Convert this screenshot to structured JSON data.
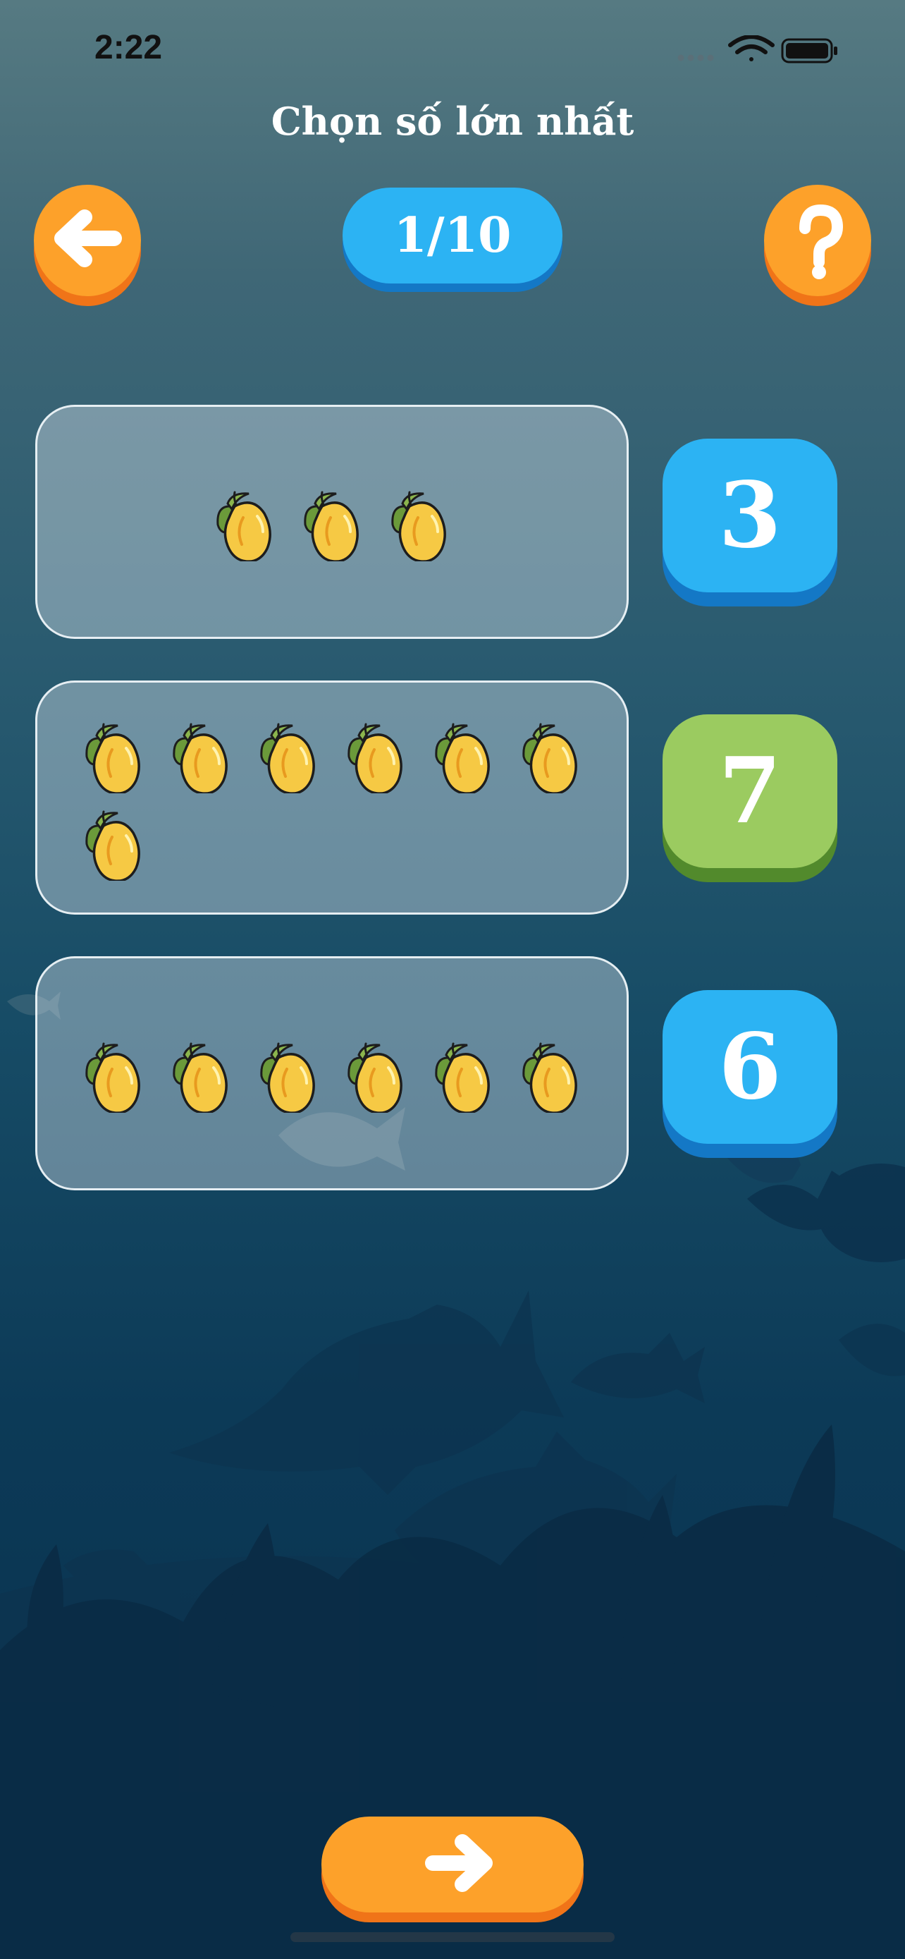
{
  "status_bar": {
    "time": "2:22"
  },
  "header": {
    "title": "Chọn số lớn nhất",
    "progress": "1/10",
    "back_icon": "arrow-left-icon",
    "help_icon": "question-mark-icon"
  },
  "options": [
    {
      "mango_count": 3,
      "answer_label": "3",
      "answer_color": "blue"
    },
    {
      "mango_count": 7,
      "answer_label": "7",
      "answer_color": "green"
    },
    {
      "mango_count": 6,
      "answer_label": "6",
      "answer_color": "blue"
    }
  ],
  "footer": {
    "next_icon": "arrow-right-icon"
  },
  "colors": {
    "orange": "#fda12a",
    "blue": "#2cb3f3",
    "green": "#9bcb60",
    "mango": "#f6c944"
  }
}
